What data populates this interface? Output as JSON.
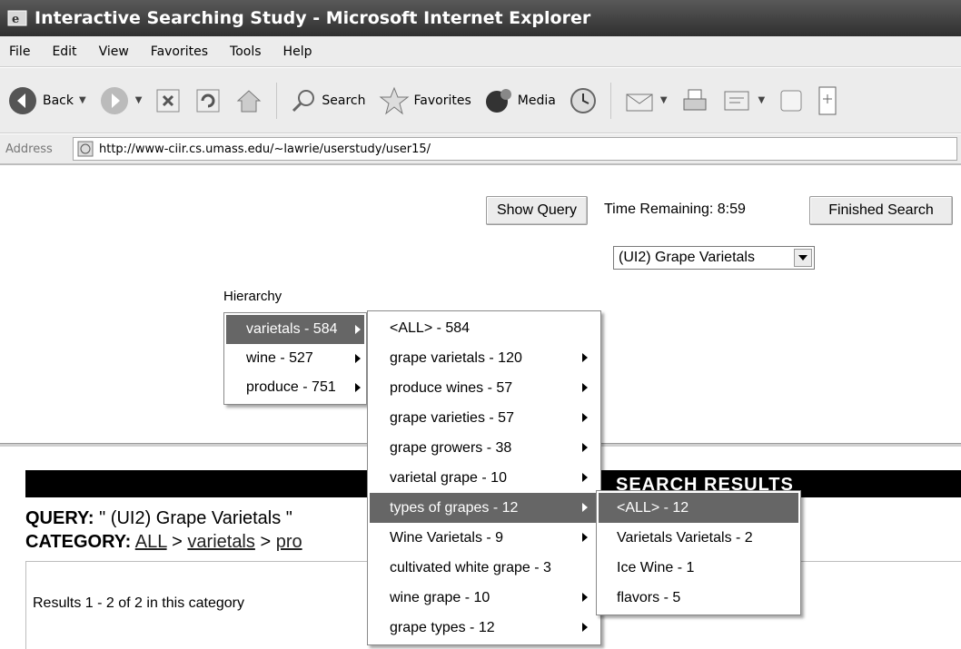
{
  "window": {
    "title": "Interactive Searching Study - Microsoft Internet Explorer"
  },
  "menubar": [
    "File",
    "Edit",
    "View",
    "Favorites",
    "Tools",
    "Help"
  ],
  "toolbar": {
    "back": "Back",
    "search": "Search",
    "favorites": "Favorites",
    "media": "Media"
  },
  "address": {
    "label": "Address",
    "url": "http://www-ciir.cs.umass.edu/~lawrie/userstudy/user15/"
  },
  "page": {
    "show_query": "Show Query",
    "time_remaining": "Time Remaining: 8:59",
    "finished_search": "Finished Search",
    "query_select": "(UI2) Grape Varietals",
    "hierarchy_label": "Hierarchy",
    "results_header": "SEARCH RESULTS",
    "query_label": "QUERY:",
    "query_value": "\" (UI2) Grape Varietals \"",
    "category_label": "CATEGORY:",
    "category_all": "ALL",
    "category_sep": ">",
    "category_varietals": "varietals",
    "category_next": "pro",
    "results_count": "Results 1 - 2 of 2 in this category"
  },
  "hierarchy_menu": [
    {
      "label": "varietals - 584",
      "submenu": true,
      "highlighted": true
    },
    {
      "label": "wine - 527",
      "submenu": true
    },
    {
      "label": "produce - 751",
      "submenu": true
    }
  ],
  "varietals_menu": [
    {
      "label": "<ALL> - 584",
      "submenu": false
    },
    {
      "label": "grape varietals - 120",
      "submenu": true
    },
    {
      "label": "produce wines - 57",
      "submenu": true
    },
    {
      "label": "grape varieties - 57",
      "submenu": true
    },
    {
      "label": "grape growers - 38",
      "submenu": true
    },
    {
      "label": "varietal grape - 10",
      "submenu": true
    },
    {
      "label": "types of grapes - 12",
      "submenu": true,
      "highlighted": true
    },
    {
      "label": "Wine Varietals - 9",
      "submenu": true
    },
    {
      "label": "cultivated white grape - 3",
      "submenu": false
    },
    {
      "label": "wine grape - 10",
      "submenu": true
    },
    {
      "label": "grape types - 12",
      "submenu": true
    }
  ],
  "types_menu": [
    {
      "label": "<ALL> - 12",
      "highlighted": true
    },
    {
      "label": "Varietals Varietals - 2"
    },
    {
      "label": "Ice Wine - 1"
    },
    {
      "label": "flavors - 5"
    }
  ],
  "icons": [
    "ie-icon",
    "back-icon",
    "forward-icon",
    "stop-icon",
    "refresh-icon",
    "home-icon",
    "search-icon",
    "favorites-icon",
    "media-icon",
    "history-icon",
    "mail-icon",
    "print-icon",
    "edit-icon",
    "page-icon",
    "messenger-icon"
  ]
}
